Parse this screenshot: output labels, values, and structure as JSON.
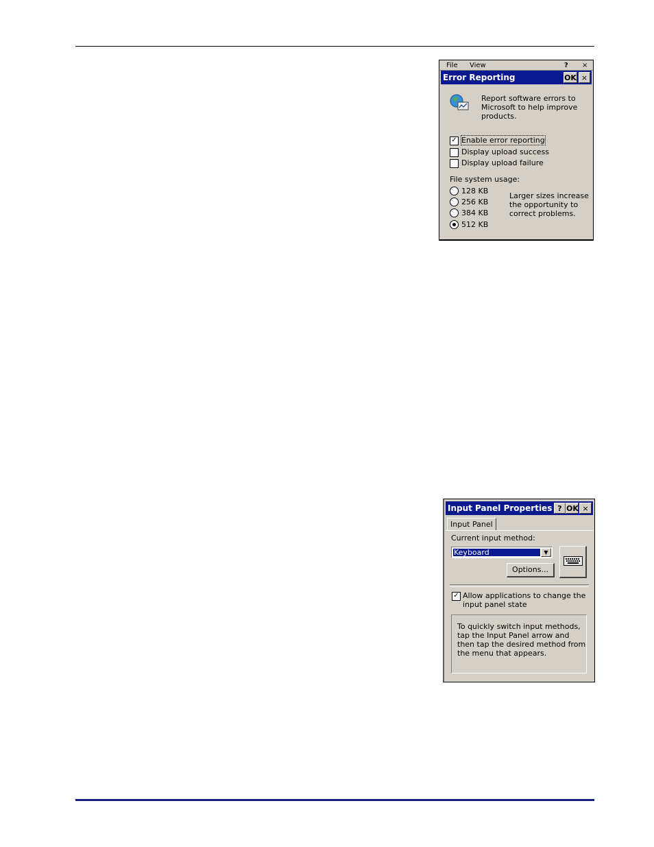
{
  "error_reporting": {
    "background_menu": [
      "File",
      "View"
    ],
    "background_buttons": [
      "?",
      "×"
    ],
    "title": "Error Reporting",
    "ok_label": "OK",
    "close_label": "×",
    "icon": "globe-report-icon",
    "description_lines": [
      "Report software errors to",
      "Microsoft to help improve",
      "products."
    ],
    "checkboxes": [
      {
        "label": "Enable error reporting",
        "checked": true
      },
      {
        "label": "Display upload success",
        "checked": false
      },
      {
        "label": "Display upload failure",
        "checked": false
      }
    ],
    "usage_label": "File system usage:",
    "sizes": [
      {
        "label": "128 KB",
        "selected": false
      },
      {
        "label": "256 KB",
        "selected": false
      },
      {
        "label": "384 KB",
        "selected": false
      },
      {
        "label": "512 KB",
        "selected": true
      }
    ],
    "hint_lines": [
      "Larger sizes increase",
      "the opportunity to",
      "correct problems."
    ]
  },
  "input_panel": {
    "title": "Input Panel Properties",
    "help_label": "?",
    "ok_label": "OK",
    "close_label": "×",
    "tab_label": "Input Panel",
    "current_method_label": "Current input method:",
    "method_value": "Keyboard",
    "options_label": "Options...",
    "keyboard_icon": "keyboard-icon",
    "allow_line1": "Allow applications to change the",
    "allow_line2": "input panel state",
    "allow_checked": true,
    "info_lines": [
      "To quickly switch input methods,",
      "tap the Input Panel arrow and",
      "then tap the desired method from",
      "the menu that appears."
    ]
  },
  "colors": {
    "title_bar": "#0a1a8e",
    "dialog_bg": "#d4d0c8",
    "footer_rule": "#1a1a7a"
  }
}
